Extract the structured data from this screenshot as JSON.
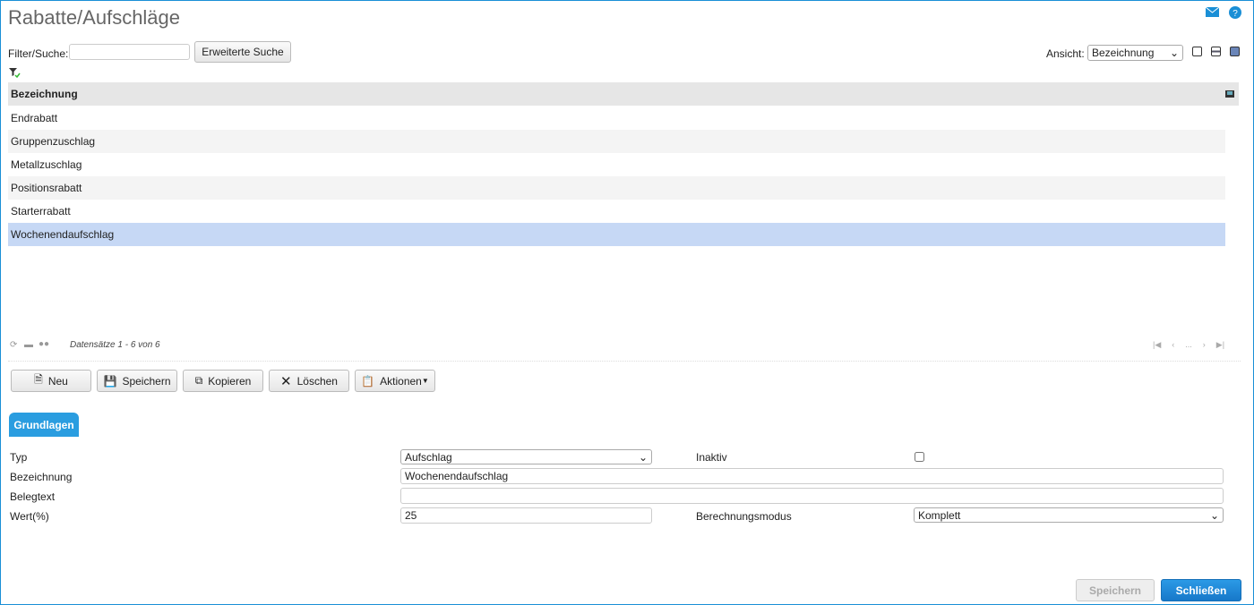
{
  "title": "Rabatte/Aufschläge",
  "filter": {
    "label": "Filter/Suche:",
    "value": "",
    "advanced_label": "Erweiterte Suche"
  },
  "view": {
    "label": "Ansicht:",
    "selected": "Bezeichnung"
  },
  "table": {
    "header": "Bezeichnung",
    "rows": [
      "Endrabatt",
      "Gruppenzuschlag",
      "Metallzuschlag",
      "Positionsrabatt",
      "Starterrabatt",
      "Wochenendaufschlag"
    ],
    "selected_index": 5
  },
  "footer": {
    "records": "Datensätze 1 - 6 von 6",
    "ellipsis": "..."
  },
  "toolbar": {
    "new": "Neu",
    "save": "Speichern",
    "copy": "Kopieren",
    "delete": "Löschen",
    "actions": "Aktionen"
  },
  "tab": "Grundlagen",
  "form": {
    "typ_label": "Typ",
    "typ_value": "Aufschlag",
    "inaktiv_label": "Inaktiv",
    "inaktiv_checked": false,
    "bez_label": "Bezeichnung",
    "bez_value": "Wochenendaufschlag",
    "beleg_label": "Belegtext",
    "beleg_value": "",
    "wert_label": "Wert(%)",
    "wert_value": "25",
    "modus_label": "Berechnungsmodus",
    "modus_value": "Komplett"
  },
  "bottom": {
    "save": "Speichern",
    "close": "Schließen"
  },
  "colors": {
    "accent": "#1a8fd6",
    "selected_row": "#c6d8f5"
  }
}
